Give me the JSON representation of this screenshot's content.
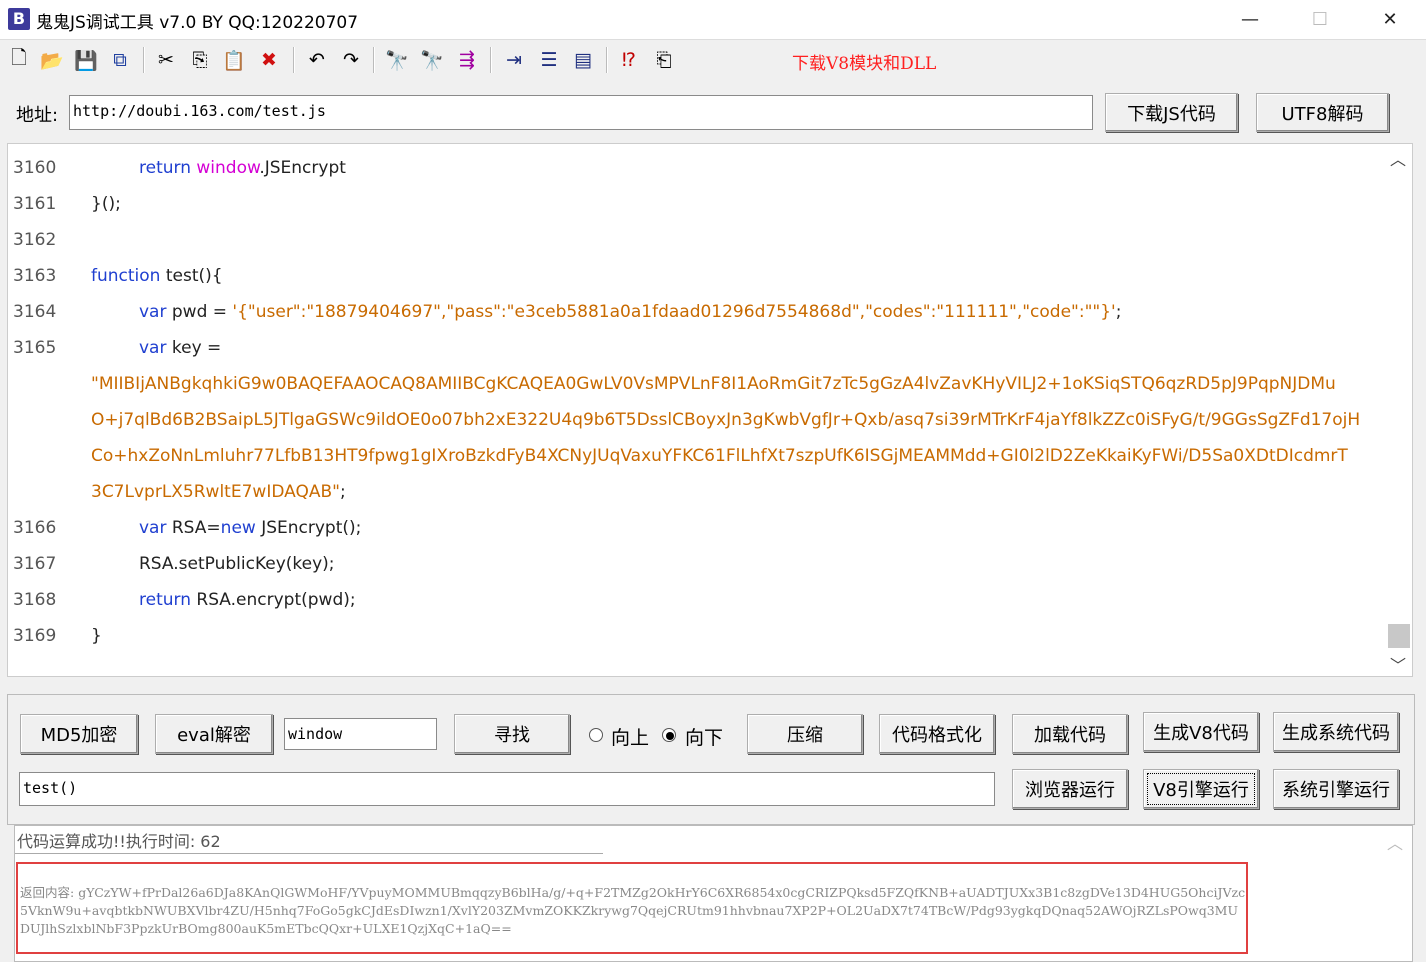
{
  "window": {
    "icon_letter": "B",
    "title": "鬼鬼JS调试工具 v7.0 BY QQ:120220707",
    "minimize": "—",
    "maximize": "☐",
    "close": "✕"
  },
  "toolbar": {
    "icons": [
      "new-file-icon",
      "open-folder-icon",
      "save-icon",
      "save-all-icon",
      "cut-icon",
      "copy-icon",
      "paste-icon",
      "delete-icon",
      "undo-icon",
      "redo-icon",
      "find-icon",
      "find-next-icon",
      "indent-icon",
      "bookmark-icon",
      "numbered-list-icon",
      "window-icon",
      "help-icon",
      "exit-icon"
    ],
    "download_v8_link": "下载V8模块和DLL"
  },
  "address": {
    "label": "地址:",
    "value": "http://doubi.163.com/test.js",
    "download_js_button": "下载JS代码",
    "utf8_decode_button": "UTF8解码"
  },
  "editor": {
    "lines": [
      {
        "num": "3160"
      },
      {
        "num": "3161",
        "text": "}();"
      },
      {
        "num": "3162"
      },
      {
        "num": "3163",
        "kw": "function",
        "text": " test(){"
      },
      {
        "num": "3164",
        "kw": "var",
        "text": " pwd = ",
        "str": "'{\"user\":\"18879404697\",\"pass\":\"e3ceb5881a0a1fdaad01296d7554868d\",\"codes\":\"111111\",\"code\":\"\"}'",
        "tail": ";"
      },
      {
        "num": "3165",
        "kw": "var",
        "text": " key ="
      },
      {
        "str": "\"MIIBIjANBgkqhkiG9w0BAQEFAAOCAQ8AMIIBCgKCAQEA0GwLV0VsMPVLnF8I1AoRmGit7zTc5gGzA4lvZavKHyVILJ2+1oKSiqSTQ6qzRD5pJ9PqpNJDMu"
      },
      {
        "str": "O+j7qlBd6B2BSaipL5JTlgaGSWc9ildOE0o07bh2xE322U4q9b6T5DsslCBoyxJn3gKwbVgfJr+Qxb/asq7si39rMTrKrF4jaYf8lkZZc0iSFyG/t/9GGsSgZFd17ojH"
      },
      {
        "str": "Co+hxZoNnLmluhr77LfbB13HT9fpwg1gIXroBzkdFyB4XCNyJUqVaxuYFKC61FlLhfXt7szpUfK6ISGjMEAMMdd+GI0l2lD2ZeKkaiKyFWi/D5Sa0XDtDIcdmrT"
      },
      {
        "str": "3C7LvprLX5RwltE7wIDAQAB\"",
        "tail": ";"
      },
      {
        "num": "3166",
        "kw": "var",
        "text": " RSA=",
        "kw2": "new",
        "text2": " JSEncrypt();"
      },
      {
        "num": "3167",
        "text": "RSA.setPublicKey(key);"
      },
      {
        "num": "3168",
        "kw": "return",
        "text": " RSA.encrypt(pwd);"
      },
      {
        "num": "3169",
        "text": "}"
      }
    ],
    "line0": {
      "kw": "return",
      "win": "window",
      "text": ".JSEncrypt"
    }
  },
  "panel": {
    "md5_button": "MD5加密",
    "eval_button": "eval解密",
    "search_value": "window",
    "find_button": "寻找",
    "radio_up": "向上",
    "radio_down": "向下",
    "compress_button": "压缩",
    "format_button": "代码格式化",
    "load_button": "加载代码",
    "gen_v8_button": "生成V8代码",
    "gen_sys_button": "生成系统代码",
    "call_value": "test()",
    "browser_run_button": "浏览器运行",
    "v8_run_button": "V8引擎运行",
    "sys_run_button": "系统引擎运行"
  },
  "output": {
    "status": "代码运算成功!!执行时间: 62",
    "result_label": "返回内容: ",
    "result_value": "gYCzYW+fPrDal26a6DJa8KAnQlGWMoHF/YVpuyMOMMUBmqqzyB6blHa/g/+q+F2TMZg2OkHrY6C6XR6854x0cgCRIZPQksd5FZQfKNB+aUADTJUXx3B1c8zgDVe13D4HUG5OhciJVzc5VknW9u+avqbtkbNWUBXVlbr4ZU/H5nhq7FoGo5gkCJdEsDIwzn1/XvlY203ZMvmZOKKZkrywg7QqejCRUtm91hhvbnau7XP2P+OL2UaDX7t74TBcW/Pdg93ygkqDQnaq52AWOjRZLsPOwq3MUDUJlhSzlxblNbF3PpzkUrBOmg800auK5mETbcQQxr+ULXE1QzjXqC+1aQ=="
  }
}
